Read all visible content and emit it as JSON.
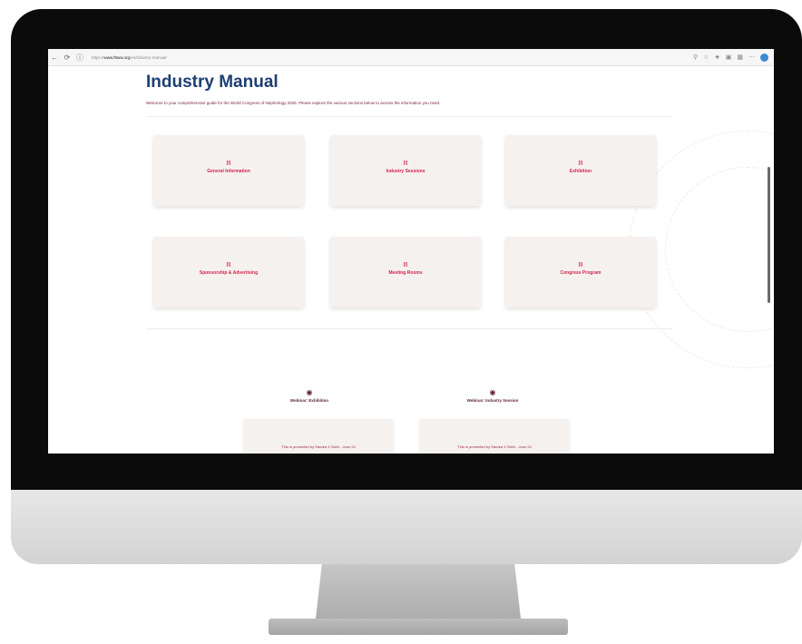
{
  "browser": {
    "url_prefix": "https://",
    "url_host": "www.f9ww.org",
    "url_path": "/en/industry-manual/",
    "icons": [
      "back-icon",
      "refresh-icon",
      "info-icon",
      "zoom-icon",
      "star-icon",
      "favorites-icon",
      "extensions-icon",
      "collections-icon",
      "more-icon",
      "profile-icon"
    ]
  },
  "page": {
    "title": "Industry Manual",
    "intro": "Welcome to your comprehensive guide for the World Congress of Nephrology 2025. Please explore the various sections below to access the information you need."
  },
  "cards": [
    {
      "icon": "[i]",
      "label": "General Information"
    },
    {
      "icon": "[i]",
      "label": "Industry Sessions"
    },
    {
      "icon": "[i]",
      "label": "Exhibition"
    },
    {
      "icon": "[i]",
      "label": "Sponsorship & Advertising"
    },
    {
      "icon": "[i]",
      "label": "Meeting Rooms"
    },
    {
      "icon": "[i]",
      "label": "Congress Program"
    }
  ],
  "videos": [
    {
      "label": "Webinar: Exhibition",
      "note": "This is presented by Sandra X Sixth - June 24"
    },
    {
      "label": "Webinar: Industry Session",
      "note": "This is presented by Sandra X Sixth - June 24"
    }
  ]
}
